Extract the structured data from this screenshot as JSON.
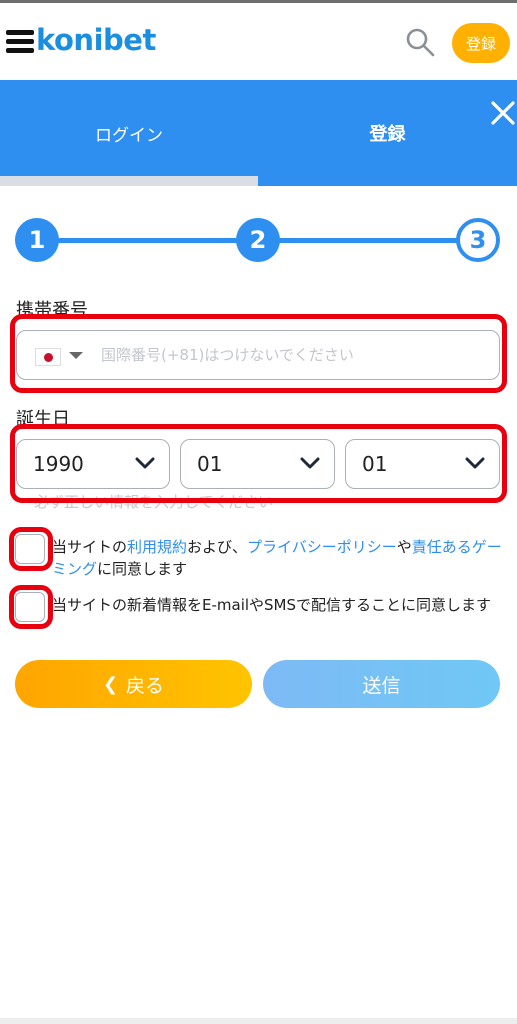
{
  "header": {
    "logo_text": "konibet",
    "register_button": "登録"
  },
  "tabs": {
    "login": "ログイン",
    "register": "登録"
  },
  "stepper": {
    "steps": [
      "1",
      "2",
      "3"
    ],
    "current": 3
  },
  "form": {
    "phone_label": "携帯番号",
    "phone_placeholder": "国際番号(+81)はつけないでください",
    "phone_country": "JP",
    "dob_label": "誕生日",
    "year": "1990",
    "month": "01",
    "day": "01",
    "hint": "必ず正しい情報を入力してください"
  },
  "agreements": {
    "terms_prefix": "当サイトの",
    "terms_link": "利用規約",
    "terms_mid": "および、",
    "privacy_link": "プライバシーポリシー",
    "terms_mid2": "や",
    "responsible_link": "責任あるゲーミング",
    "terms_suffix": "に同意します",
    "newsletter": "当サイトの新着情報をE-mailやSMSで配信することに同意します"
  },
  "buttons": {
    "back": "戻る",
    "submit": "送信"
  },
  "colors": {
    "primary": "#2e8ff0",
    "accent": "#ffb000",
    "highlight": "#e8000f"
  }
}
